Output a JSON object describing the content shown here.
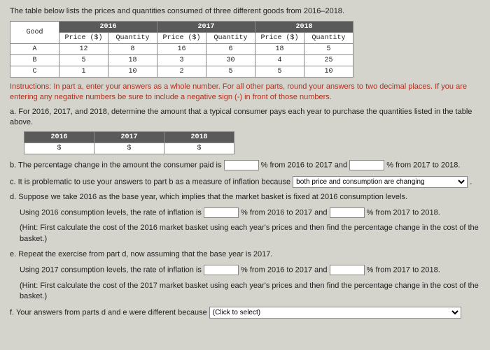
{
  "intro": "The table below lists the prices and quantities consumed of three different goods from 2016–2018.",
  "years": {
    "y1": "2016",
    "y2": "2017",
    "y3": "2018"
  },
  "cols": {
    "good": "Good",
    "price": "Price ($)",
    "qty": "Quantity"
  },
  "rows": [
    {
      "good": "A",
      "p1": "12",
      "q1": "8",
      "p2": "16",
      "q2": "6",
      "p3": "18",
      "q3": "5"
    },
    {
      "good": "B",
      "p1": "5",
      "q1": "18",
      "p2": "3",
      "q2": "30",
      "p3": "4",
      "q3": "25"
    },
    {
      "good": "C",
      "p1": "1",
      "q1": "10",
      "p2": "2",
      "q2": "5",
      "p3": "5",
      "q3": "10"
    }
  ],
  "instr": "Instructions: In part a, enter your answers as a whole number. For all other parts, round your answers to two decimal places. If you are entering any negative numbers be sure to include a negative sign (-) in front of those numbers.",
  "qa": "a. For 2016, 2017, and 2018, determine the amount that a typical consumer pays each year to purchase the quantities listed in the table above.",
  "dollar": "$",
  "qb_pre": "b. The percentage change in the amount the consumer paid is ",
  "pct_a": "% from 2016 to 2017 and ",
  "pct_b": "% from 2017 to 2018.",
  "qc_pre": "c. It is problematic to use your answers to part b as a measure of inflation because ",
  "qc_sel": "both price and consumption are changing",
  "period": ".",
  "qd": "d. Suppose we take 2016 as the base year, which implies that the market basket is fixed at 2016 consumption levels.",
  "qd_line": "Using 2016 consumption levels, the rate of inflation is ",
  "qd_hint": "(Hint: First calculate the cost of the 2016 market basket using each year's prices and then find the percentage change in the cost of the basket.)",
  "qe": "e. Repeat the exercise from part d, now assuming that the base year is 2017.",
  "qe_line": "Using 2017 consumption levels, the rate of inflation is ",
  "qe_hint": "(Hint: First calculate the cost of the 2017 market basket using each year's prices and then find the percentage change in the cost of the basket.)",
  "qf_pre": "f. Your answers from parts d and e were different because ",
  "qf_sel": "(Click to select)"
}
